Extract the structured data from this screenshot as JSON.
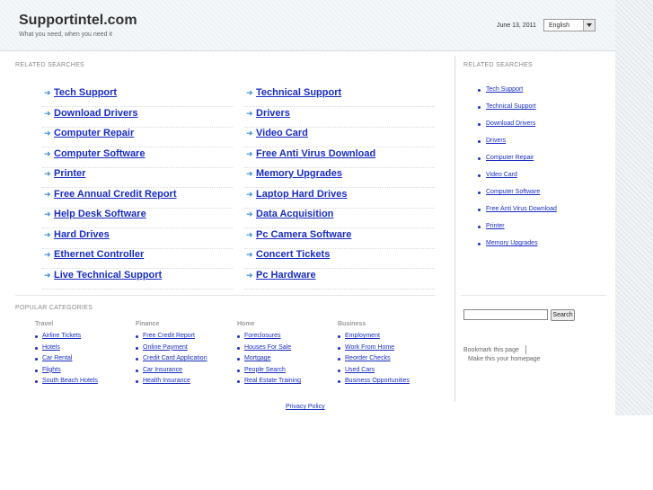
{
  "header": {
    "site_title": "Supportintel.com",
    "tagline": "What you need, when you need it",
    "date": "June 13, 2011",
    "language": "English"
  },
  "related_searches": {
    "label": "RELATED SEARCHES",
    "left_column": [
      "Tech Support",
      "Download Drivers",
      "Computer Repair",
      "Computer Software",
      "Printer",
      "Free Annual Credit Report",
      "Help Desk Software",
      "Hard Drives",
      "Ethernet Controller",
      "Live Technical Support"
    ],
    "right_column": [
      "Technical Support",
      "Drivers",
      "Video Card",
      "Free Anti Virus Download",
      "Memory Upgrades",
      "Laptop Hard Drives",
      "Data Acquisition",
      "Pc Camera Software",
      "Concert Tickets",
      "Pc Hardware"
    ]
  },
  "sidebar": {
    "label": "RELATED SEARCHES",
    "items": [
      "Tech Support",
      "Technical Support",
      "Download Drivers",
      "Drivers",
      "Computer Repair",
      "Video Card",
      "Computer Software",
      "Free Anti Virus Download",
      "Printer",
      "Memory Upgrades"
    ],
    "search_button": "Search",
    "bookmark": "Bookmark this page",
    "homepage": "Make this your homepage"
  },
  "popular_categories": {
    "label": "POPULAR CATEGORIES",
    "columns": [
      {
        "title": "Travel",
        "items": [
          "Airline Tickets",
          "Hotels",
          "Car Rental",
          "Flights",
          "South Beach Hotels"
        ]
      },
      {
        "title": "Finance",
        "items": [
          "Free Credit Report",
          "Online Payment",
          "Credit Card Application",
          "Car Insurance",
          "Health Insurance"
        ]
      },
      {
        "title": "Home",
        "items": [
          "Foreclosures",
          "Houses For Sale",
          "Mortgage",
          "People Search",
          "Real Estate Training"
        ]
      },
      {
        "title": "Business",
        "items": [
          "Employment",
          "Work From Home",
          "Reorder Checks",
          "Used Cars",
          "Business Opportunities"
        ]
      }
    ]
  },
  "footer": {
    "privacy": "Privacy Policy"
  }
}
